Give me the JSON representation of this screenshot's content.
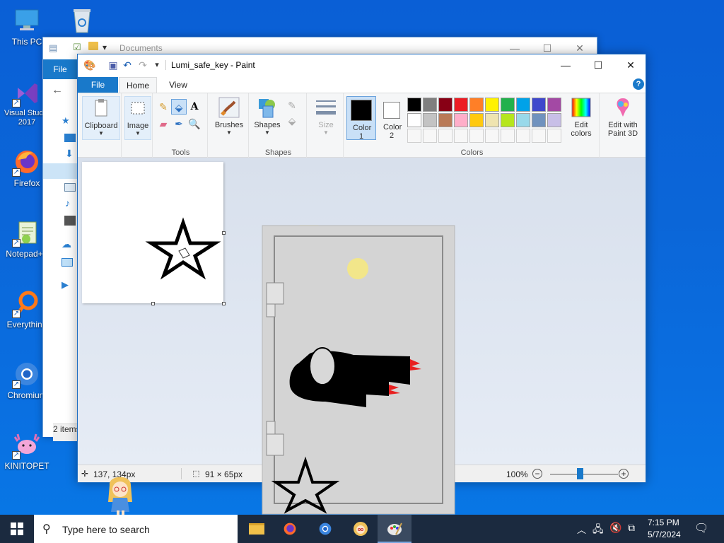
{
  "desktop": {
    "icons": [
      {
        "label": "This PC"
      },
      {
        "label": ""
      },
      {
        "label": "Visual Studio 2017"
      },
      {
        "label": "Firefox"
      },
      {
        "label": "Notepad++"
      },
      {
        "label": "Everything"
      },
      {
        "label": "Chromium"
      },
      {
        "label": "KINITOPET"
      }
    ]
  },
  "explorer": {
    "title": "Documents",
    "file_tab": "File",
    "status": "2 items"
  },
  "paint": {
    "title": "Lumi_safe_key - Paint",
    "tabs": {
      "file": "File",
      "home": "Home",
      "view": "View"
    },
    "groups": {
      "clipboard": "Clipboard",
      "image": "Image",
      "tools": "Tools",
      "brushes": "Brushes",
      "shapes": "Shapes",
      "size": "Size",
      "color1": "Color 1",
      "color2": "Color 2",
      "colors": "Colors",
      "edit_colors": "Edit colors",
      "edit_paint3d": "Edit with Paint 3D"
    },
    "palette": {
      "row1": [
        "#000000",
        "#7f7f7f",
        "#880015",
        "#ed1c24",
        "#ff7f27",
        "#fff200",
        "#22b14c",
        "#00a2e8",
        "#3f48cc",
        "#a349a4"
      ],
      "row2": [
        "#ffffff",
        "#c3c3c3",
        "#b97a57",
        "#ffaec9",
        "#ffc90e",
        "#efe4b0",
        "#b5e61d",
        "#99d9ea",
        "#7092be",
        "#c8bfe7"
      ]
    },
    "color1": "#000000",
    "color2": "#ffffff",
    "status": {
      "cursor_pos": "137, 134px",
      "selection_size": "91 × 65px",
      "zoom": "100%"
    }
  },
  "taskbar": {
    "search_placeholder": "Type here to search",
    "time": "7:15 PM",
    "date": "5/7/2024"
  }
}
